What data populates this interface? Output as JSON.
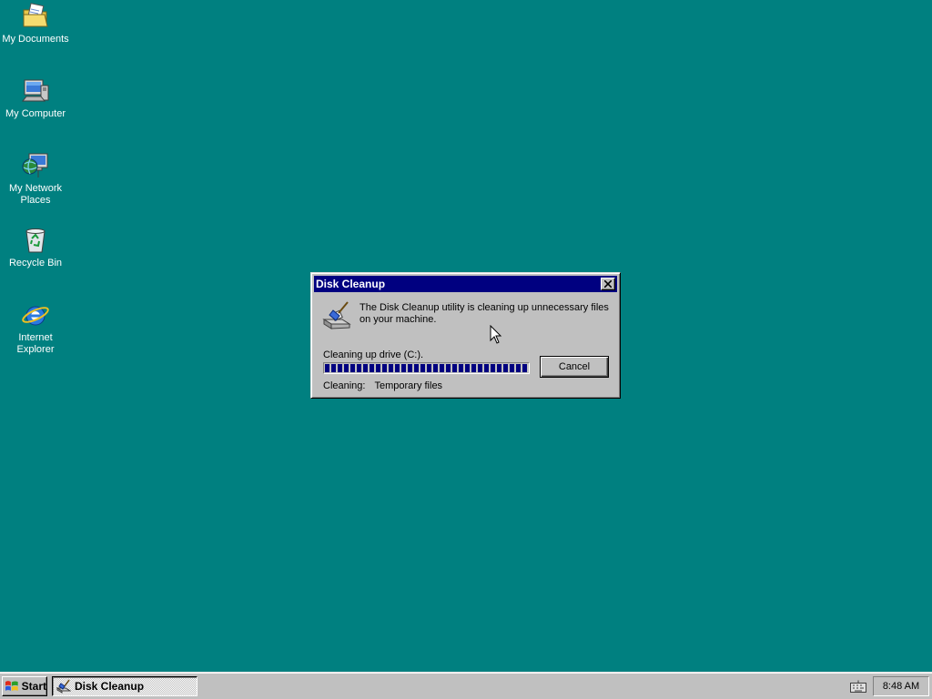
{
  "desktop": {
    "icons": [
      {
        "label": "My Documents",
        "icon": "my-documents-icon"
      },
      {
        "label": "My Computer",
        "icon": "my-computer-icon"
      },
      {
        "label": "My Network\nPlaces",
        "icon": "my-network-places-icon"
      },
      {
        "label": "Recycle Bin",
        "icon": "recycle-bin-icon"
      },
      {
        "label": "Internet\nExplorer",
        "icon": "internet-explorer-icon"
      }
    ],
    "background_color": "#008080"
  },
  "dialog": {
    "title": "Disk Cleanup",
    "message": "The Disk Cleanup utility is cleaning up unnecessary files on your machine.",
    "drive_label": "Cleaning up drive  (C:).",
    "progress_fraction": 1.0,
    "cancel_label": "Cancel",
    "cleaning_label": "Cleaning:",
    "cleaning_value": "Temporary files",
    "titlebar_color": "#000080",
    "progress_color": "#000080"
  },
  "taskbar": {
    "start_label": "Start",
    "task_label": "Disk Cleanup",
    "clock": "8:48 AM"
  }
}
